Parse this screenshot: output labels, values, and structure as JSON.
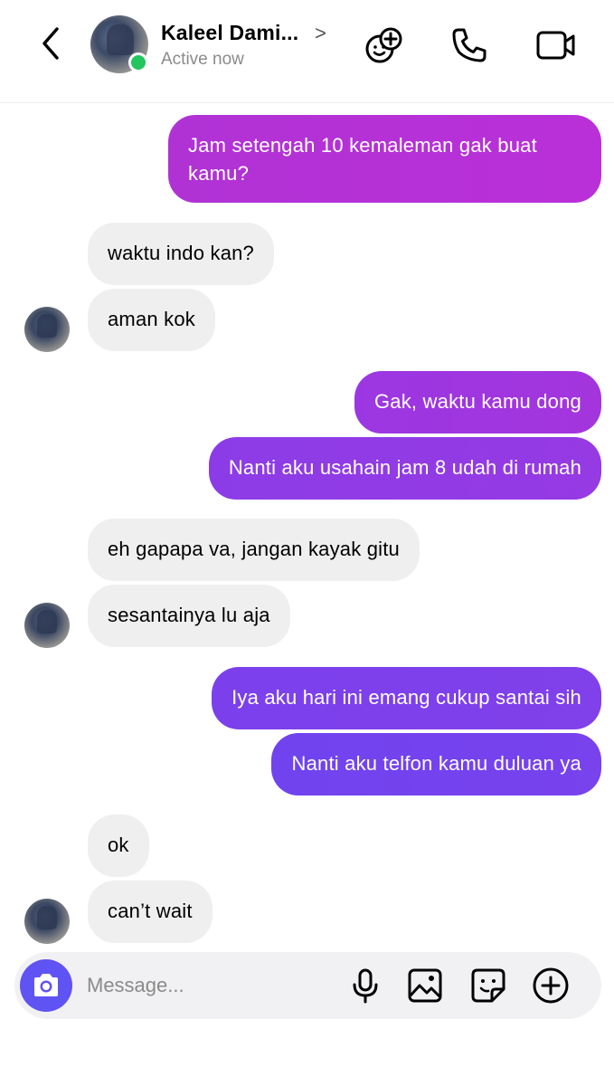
{
  "header": {
    "contact_name": "Kaleel Dami...",
    "status": "Active now",
    "name_chevron": ">"
  },
  "messages": [
    {
      "dir": "out",
      "text": "Jam setengah 10 kemaleman gak buat kamu?"
    },
    {
      "dir": "in",
      "text": "waktu indo kan?"
    },
    {
      "dir": "in",
      "text": "aman kok"
    },
    {
      "dir": "out",
      "text": "Gak, waktu kamu dong"
    },
    {
      "dir": "out",
      "text": "Nanti aku usahain jam 8 udah di rumah"
    },
    {
      "dir": "in",
      "text": "eh gapapa va, jangan kayak gitu"
    },
    {
      "dir": "in",
      "text": "sesantainya lu aja"
    },
    {
      "dir": "out",
      "text": "Iya aku hari ini emang cukup santai sih"
    },
    {
      "dir": "out",
      "text": "Nanti aku telfon kamu duluan ya"
    },
    {
      "dir": "in",
      "text": "ok"
    },
    {
      "dir": "in",
      "text": "can’t wait"
    }
  ],
  "composer": {
    "placeholder": "Message..."
  },
  "colors": {
    "accent": "#5f53f3",
    "online": "#22c55e",
    "incoming_bubble": "#efefef",
    "outgoing_gradient": [
      "#b331d6",
      "#a534dc",
      "#8e3ce6",
      "#7b41ec",
      "#7244ee"
    ]
  },
  "icons": {
    "back": "chevron-left-icon",
    "add_people": "add-people-icon",
    "call": "phone-icon",
    "video": "video-camera-icon",
    "camera": "camera-icon",
    "mic": "microphone-icon",
    "gallery": "image-icon",
    "sticker": "sticker-icon",
    "more": "plus-circle-icon"
  }
}
